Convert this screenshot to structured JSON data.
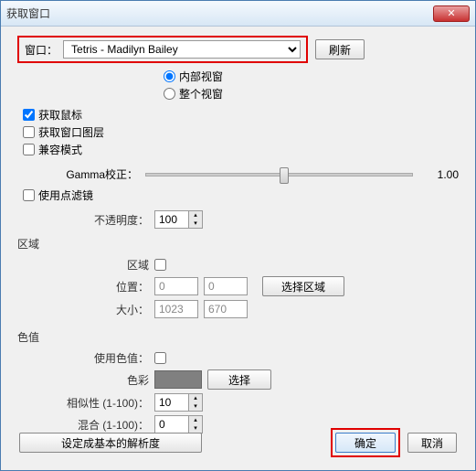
{
  "title": "获取窗口",
  "topRow": {
    "label": "窗口：",
    "selected": "Tetris - Madilyn Bailey",
    "refresh": "刷新"
  },
  "radios": {
    "inner": "内部视窗",
    "whole": "整个视窗"
  },
  "checks": {
    "captureCursor": "获取鼠标",
    "captureLayers": "获取窗口图层",
    "compat": "兼容模式"
  },
  "gamma": {
    "label": "Gamma校正：",
    "value": "1.00"
  },
  "pointFilter": {
    "label": "使用点滤镜"
  },
  "opacity": {
    "label": "不透明度：",
    "value": "100"
  },
  "region": {
    "title": "区域",
    "regionChk": "区域",
    "posLabel": "位置：",
    "posX": "0",
    "posY": "0",
    "selectRegion": "选择区域",
    "sizeLabel": "大小：",
    "sizeW": "1023",
    "sizeH": "670"
  },
  "color": {
    "title": "色值",
    "useColor": "使用色值：",
    "colorLabel": "色彩",
    "select": "选择",
    "similarity": "相似性 (1-100)：",
    "similarityVal": "10",
    "blend": "混合 (1-100)：",
    "blendVal": "0"
  },
  "footer": {
    "setBasic": "设定成基本的解析度",
    "ok": "确定",
    "cancel": "取消"
  }
}
